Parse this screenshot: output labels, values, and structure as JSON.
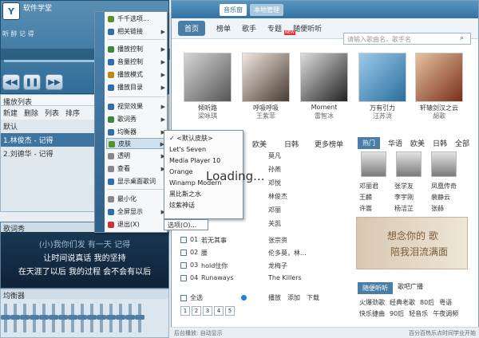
{
  "player": {
    "logo": "Y",
    "title": "软件学堂",
    "song": "听 醉 记 得",
    "controls": [
      "◀◀",
      "❚❚",
      "▶▶"
    ],
    "playlist_header": "播放列表",
    "playlist_tabs": [
      "新建",
      "删除",
      "列表",
      "排序"
    ],
    "playlist_rows": [
      "默认",
      "1.林俊杰 - 记得",
      "2.刘德华 - 记得"
    ],
    "lyrics_header": "歌词秀",
    "lyrics_lines": [
      "(小)我你们发 有一天 记得",
      "让时间说真话 我的坚持",
      "在天涯了以后 我的过程 会不会有以后"
    ],
    "eq_header": "均衡器",
    "eq_slider_count": 15
  },
  "menu": {
    "side_text": "千千静听 - 百度音乐",
    "items": [
      {
        "label": "千千选项...",
        "arrow": false,
        "color": "#5b8f2a"
      },
      {
        "label": "相关链接",
        "arrow": true,
        "color": "#2c6fb0"
      },
      {
        "label": "播放控制",
        "arrow": true,
        "color": "#3a8a3a"
      },
      {
        "label": "音量控制",
        "arrow": true,
        "color": "#2c6fb0"
      },
      {
        "label": "播放模式",
        "arrow": true,
        "color": "#c6851a"
      },
      {
        "label": "播放目录",
        "arrow": true,
        "color": "#2c6fb0"
      },
      {
        "label": "视觉效果",
        "arrow": true,
        "color": "#2c6fb0"
      },
      {
        "label": "歌词秀",
        "arrow": true,
        "color": "#3a8a3a"
      },
      {
        "label": "均衡器",
        "arrow": true,
        "color": "#2c6fb0"
      },
      {
        "label": "皮肤",
        "arrow": true,
        "color": "#5b8f2a"
      },
      {
        "label": "透明",
        "arrow": true,
        "color": "#888"
      },
      {
        "label": "查看",
        "arrow": true,
        "color": "#888"
      },
      {
        "label": "显示桌面歌词",
        "arrow": false,
        "color": "#2c6fb0"
      },
      {
        "label": "最小化",
        "arrow": false,
        "color": "#888"
      },
      {
        "label": "全屏显示",
        "arrow": true,
        "color": "#2c6fb0"
      },
      {
        "label": "退出(X)",
        "arrow": false,
        "color": "#c33"
      }
    ]
  },
  "submenu": {
    "items": [
      "✓ <默认皮肤>",
      "Let's Seven",
      "Media Player 10",
      "Orange",
      "Winamp Modern",
      "黑比斯之水",
      "炫紫神话"
    ],
    "options": "选项(O)..."
  },
  "loading_text": "Loading...",
  "music": {
    "top_tabs": [
      "音乐窗",
      "本地管理"
    ],
    "nav": [
      "首页",
      "榜单",
      "歌手",
      "专题",
      "随便听听"
    ],
    "new_badge": "NEW",
    "search_placeholder": "请输入歌曲名，歌手名",
    "albums": [
      {
        "title": "倾听路",
        "artist": "梁咏琪"
      },
      {
        "title": "呼吸呼吸",
        "artist": "王紫菲"
      },
      {
        "title": "Moment",
        "artist": "雷智冰"
      },
      {
        "title": "万有引力",
        "artist": "汪苏泷"
      },
      {
        "title": "轩辕剑汉之云",
        "artist": "胡歌"
      }
    ],
    "artist_tabs": [
      "欧美",
      "日韩",
      "更多榜单"
    ],
    "hot_tabs": [
      "热门",
      "华语",
      "欧美",
      "日韩",
      "全部"
    ],
    "hot_artists": [
      {
        "name": "邓丽君",
        "sub": "王麟"
      },
      {
        "name": "张学友",
        "sub": "李宇刚"
      },
      {
        "name": "凤凰传奇",
        "sub": "裴静云"
      }
    ],
    "hot_artists_row3": [
      "许嵩",
      "杨洁芷",
      "张赫"
    ],
    "songs": [
      {
        "n": "01",
        "title": "若无其事",
        "artist": "张宗资"
      },
      {
        "n": "02",
        "title": "腰",
        "artist": "伦多莫，林..."
      },
      {
        "n": "03",
        "title": "hold住你",
        "artist": "龙梅子"
      },
      {
        "n": "04",
        "title": "Runaways",
        "artist": "The Killers"
      }
    ],
    "list_artists": [
      "莫凡",
      "孙燕",
      "邓悦",
      "林俊杰",
      "邓丽",
      "关凯"
    ],
    "select_all": "全选",
    "play_btn": "播放",
    "add_btn": "添加",
    "download_btn": "下载",
    "pages": [
      "1",
      "2",
      "3",
      "4",
      "5"
    ],
    "banner_l1": "想念你的 歌",
    "banner_l2": "陪我泪流满面",
    "radio_tabs": [
      "随便听听",
      "歌吧广播"
    ],
    "radio_items": [
      "火爆劲歌",
      "经典老歌",
      "80后",
      "粤语",
      "快乐捷曲",
      "90后",
      "轻音乐",
      "午夜调频"
    ],
    "status": "后台播放: 自动显示",
    "status_right": "百分百热乐点时间学业开始"
  }
}
